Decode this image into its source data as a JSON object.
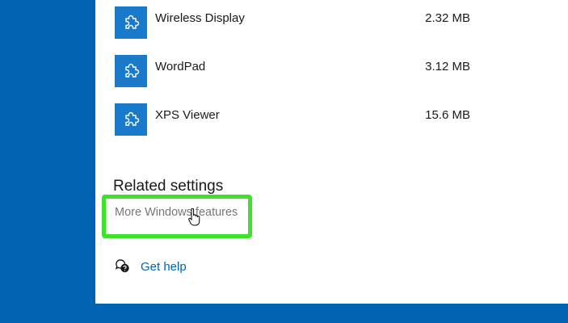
{
  "features": [
    {
      "name": "Wireless Display",
      "size": "2.32 MB",
      "icon": "puzzle-icon"
    },
    {
      "name": "WordPad",
      "size": "3.12 MB",
      "icon": "puzzle-icon"
    },
    {
      "name": "XPS Viewer",
      "size": "15.6 MB",
      "icon": "puzzle-icon"
    }
  ],
  "related": {
    "heading": "Related settings",
    "more_features_label": "More Windows features"
  },
  "help": {
    "label": "Get help",
    "icon": "chat-help-icon"
  },
  "colors": {
    "accent": "#0063b1",
    "tile": "#1979ca",
    "highlight": "#3de22a"
  }
}
